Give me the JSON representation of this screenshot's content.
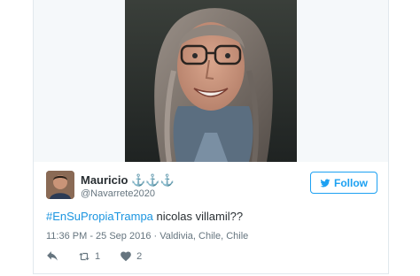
{
  "tweet": {
    "display_name": "Mauricio ⚓⚓⚓",
    "screen_name": "@Navarrete2020",
    "follow_label": "Follow",
    "hashtag": "#EnSuPropiaTrampa",
    "text": " nicolas villamil??",
    "timestamp": "11:36 PM - 25 Sep 2016 · Valdivia, Chile, Chile",
    "retweet_count": "1",
    "like_count": "2"
  },
  "icons": {
    "follow": "twitter-bird-icon",
    "reply": "reply-icon",
    "retweet": "retweet-icon",
    "like": "heart-icon"
  },
  "colors": {
    "accent": "#1da1f2",
    "hashtag": "#1b95e0",
    "text": "#292f33",
    "muted": "#66757f",
    "border": "#e1e8ed"
  }
}
